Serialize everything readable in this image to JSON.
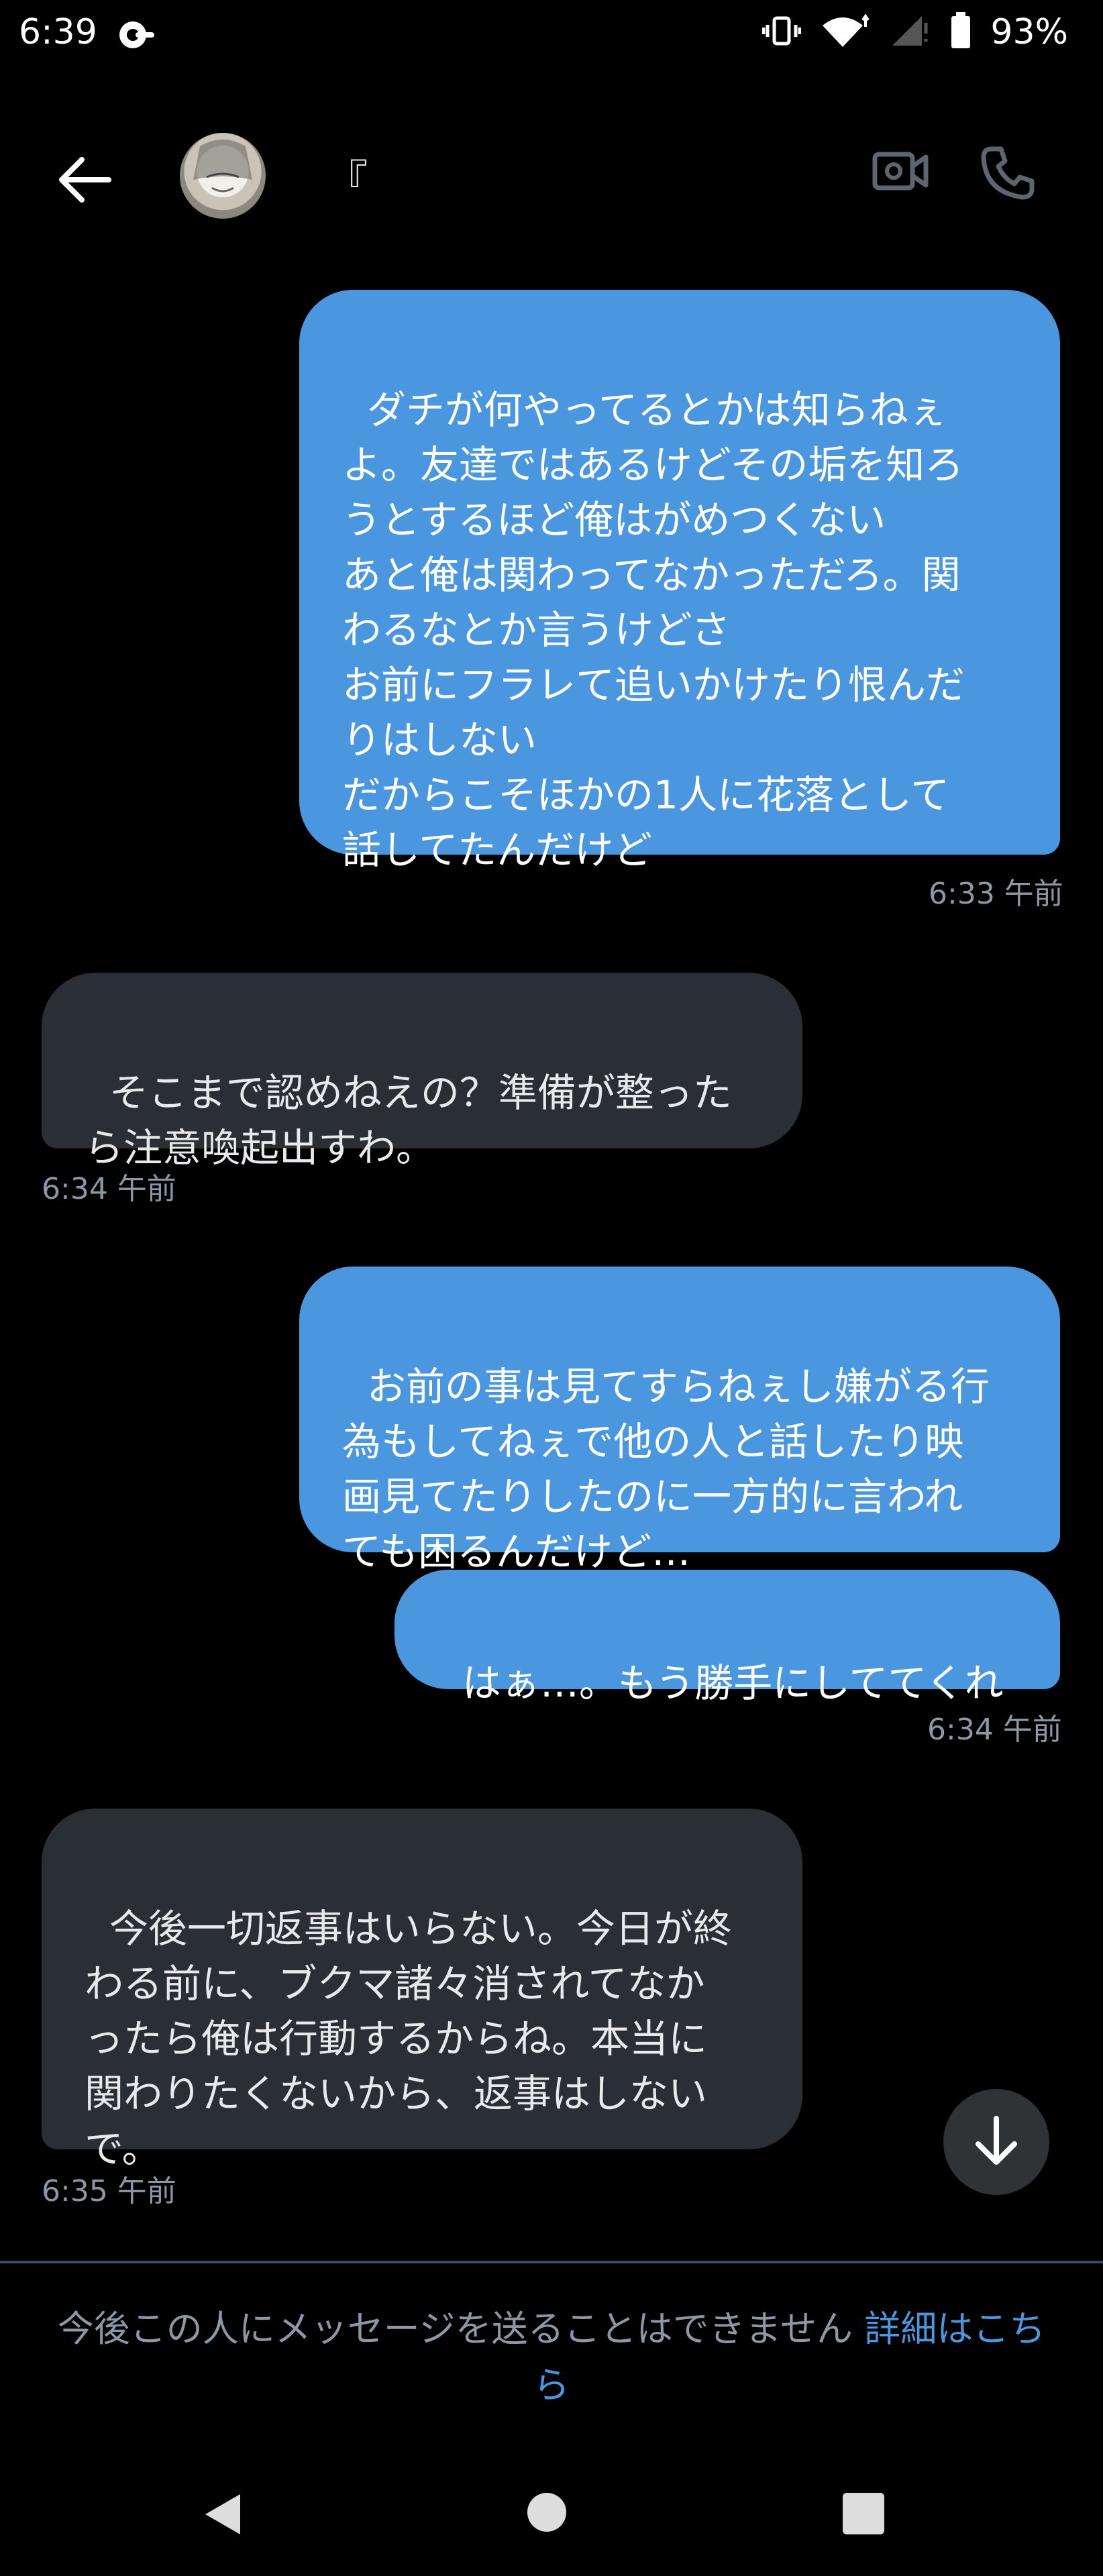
{
  "status_bar": {
    "time": "6:39",
    "battery": "93%"
  },
  "header": {
    "name": "『"
  },
  "messages": [
    {
      "side": "sent",
      "text": "ダチが何やってるとかは知らねぇ\nよ。友達ではあるけどその垢を知ろ\nうとするほど俺はがめつくない\nあと俺は関わってなかっただろ。関\nわるなとか言うけどさ\nお前にフラレて追いかけたり恨んだ\nりはしない\nだからこそほかの1人に花落として\n話してたんだけど",
      "time": "6:33 午前"
    },
    {
      "side": "recv",
      "text": "そこまで認めねえの？準備が整った\nら注意喚起出すわ。",
      "time": "6:34 午前"
    },
    {
      "side": "sent",
      "text": "お前の事は見てすらねぇし嫌がる行\n為もしてねぇで他の人と話したり映\n画見てたりしたのに一方的に言われ\nても困るんだけど…"
    },
    {
      "side": "sent",
      "text": "はぁ…。もう勝手にしててくれ",
      "time": "6:34 午前"
    },
    {
      "side": "recv",
      "text": "今後一切返事はいらない。今日が終\nわる前に、ブクマ諸々消されてなか\nったら俺は行動するからね。本当に\n関わりたくないから、返事はしない\nで。",
      "time": "6:35 午前"
    }
  ],
  "footer": {
    "notice_text": "今後この人にメッセージを送ることはできません ",
    "notice_link": "詳細はこちら"
  },
  "icons": {
    "back": "arrow-left-icon",
    "video": "video-camera-icon",
    "phone": "phone-icon",
    "scroll": "arrow-down-icon"
  },
  "colors": {
    "sent_bubble": "#4a97e0",
    "received_bubble": "#2a2f35",
    "link": "#4a97e0"
  }
}
